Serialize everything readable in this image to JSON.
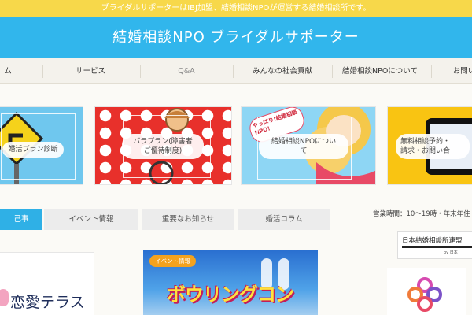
{
  "notice": "ブライダルサポーターはIBJ加盟、結婚相談NPOが運営する結婚相談所です。",
  "header_title": "結婚相談NPO ブライダルサポーター",
  "nav": [
    "ム",
    "サービス",
    "Q&A",
    "みんなの社会貢献",
    "結婚相談NPOについて",
    "お問い"
  ],
  "banners": [
    {
      "label": "婚活プラン診断"
    },
    {
      "label": "バラプラン(障害者\nご優待制度)"
    },
    {
      "label": "結婚相談NPOについ\nて",
      "sign": "やっぱり!結婚相談NPO!"
    },
    {
      "label": "無料相談予約・\n請求・お問い合"
    }
  ],
  "tabs": [
    "己事",
    "イベント情報",
    "重要なお知らせ",
    "婚活コラム"
  ],
  "hours": "営業時間：10～19時・年末年住",
  "ibj": {
    "text": "日本結婚相談所連盟",
    "sub": "by 日本"
  },
  "card1": {
    "text": "恋愛テラス"
  },
  "card2": {
    "badge": "イベント情報",
    "title": "ボウリングコン"
  },
  "colors": {
    "notice": "#f7d84a",
    "header": "#31b6ec",
    "tab_active": "#2fb0e6",
    "badge": "#f4a21e"
  }
}
